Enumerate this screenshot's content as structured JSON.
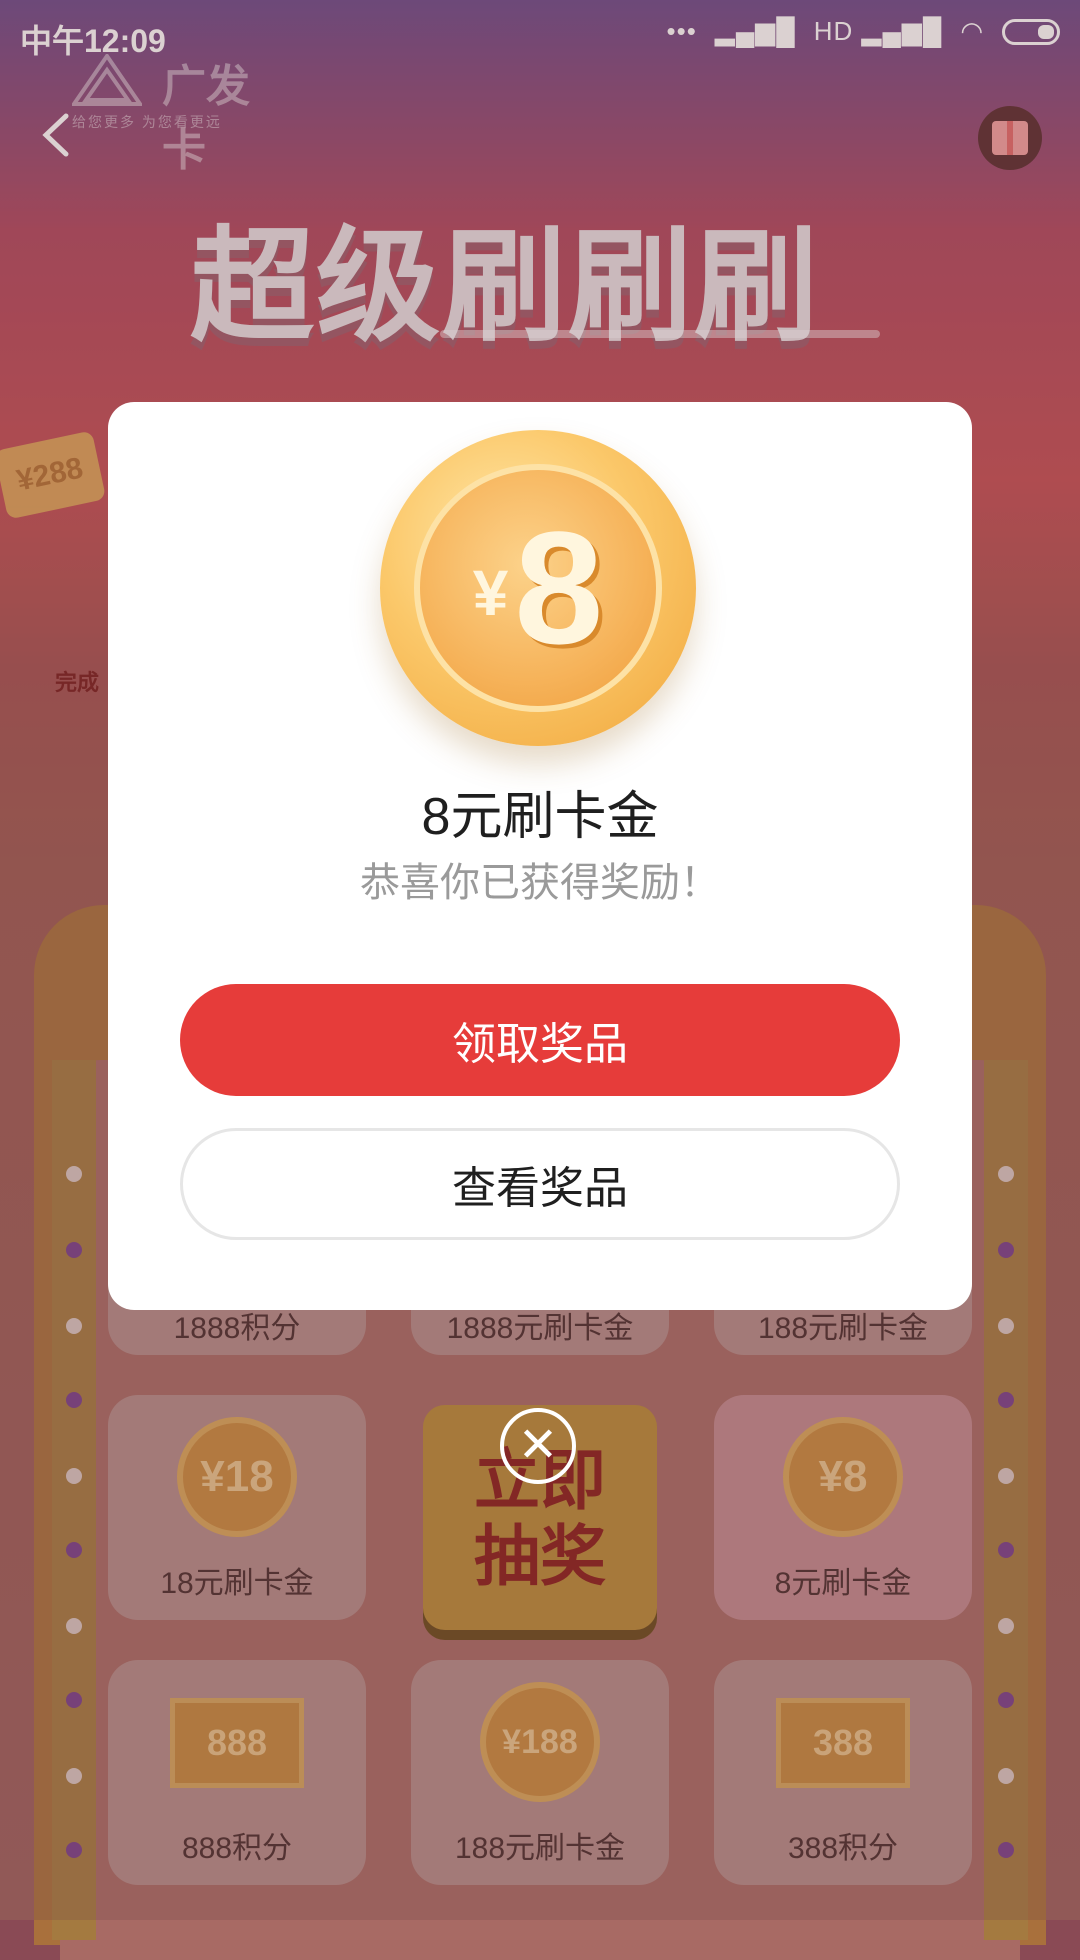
{
  "status_bar": {
    "time": "中午12:09",
    "dots": "•••",
    "signal_1": "▂▄▆█",
    "signal_2": "HD ▂▄▆█",
    "wifi": "◠"
  },
  "brand": {
    "name": "广发卡",
    "slogan": "给您更多  为您看更远"
  },
  "page": {
    "headline": "超级刷刷刷",
    "side_note": "完成",
    "ticket_text": "¥288"
  },
  "prizes": {
    "row1": [
      "1888积分",
      "1888元刷卡金",
      "188元刷卡金"
    ],
    "row2": [
      {
        "coin": "¥18",
        "label": "18元刷卡金"
      },
      {
        "label": "8元刷卡金",
        "coin": "¥8"
      }
    ],
    "draw_button": [
      "立即",
      "抽奖"
    ],
    "row3": [
      {
        "badge": "888",
        "label": "888积分"
      },
      {
        "coin": "¥188",
        "label": "188元刷卡金"
      },
      {
        "badge": "388",
        "label": "388积分"
      }
    ]
  },
  "modal": {
    "coin_currency": "¥",
    "coin_amount": "8",
    "title": "8元刷卡金",
    "subtitle": "恭喜你已获得奖励！",
    "primary_button": "领取奖品",
    "secondary_button": "查看奖品",
    "close_symbol": "✕"
  },
  "colors": {
    "primary": "#e63c3a",
    "modal_bg": "#ffffff",
    "coin": "#f6b35a"
  }
}
